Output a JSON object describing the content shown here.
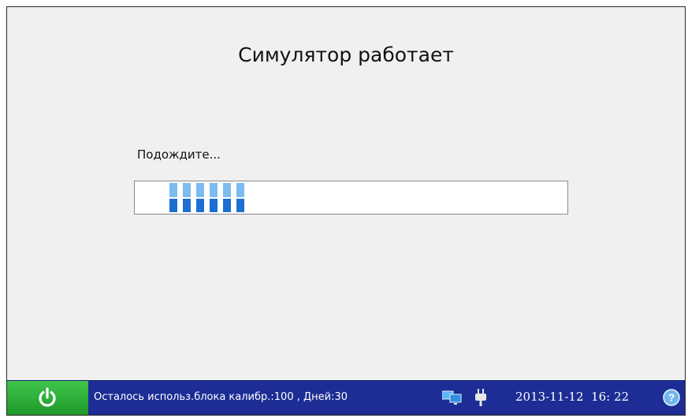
{
  "window": {
    "title": "Симулятор работает",
    "status_text": "Подождите...",
    "progress_blocks_filled": 6
  },
  "taskbar": {
    "power_icon": "power-icon",
    "calibration_text": "Осталось использ.блока калибр.:100 , Дней:30",
    "network_icon": "network-icon",
    "power_plug_icon": "plug-icon",
    "date": "2013-11-12",
    "time": "16: 22",
    "help_icon": "help-icon"
  },
  "colors": {
    "taskbar_bg": "#1d2d95",
    "power_button": "#2fb23b",
    "progress_light": "#7cbcf0",
    "progress_dark": "#1c6fd1"
  }
}
